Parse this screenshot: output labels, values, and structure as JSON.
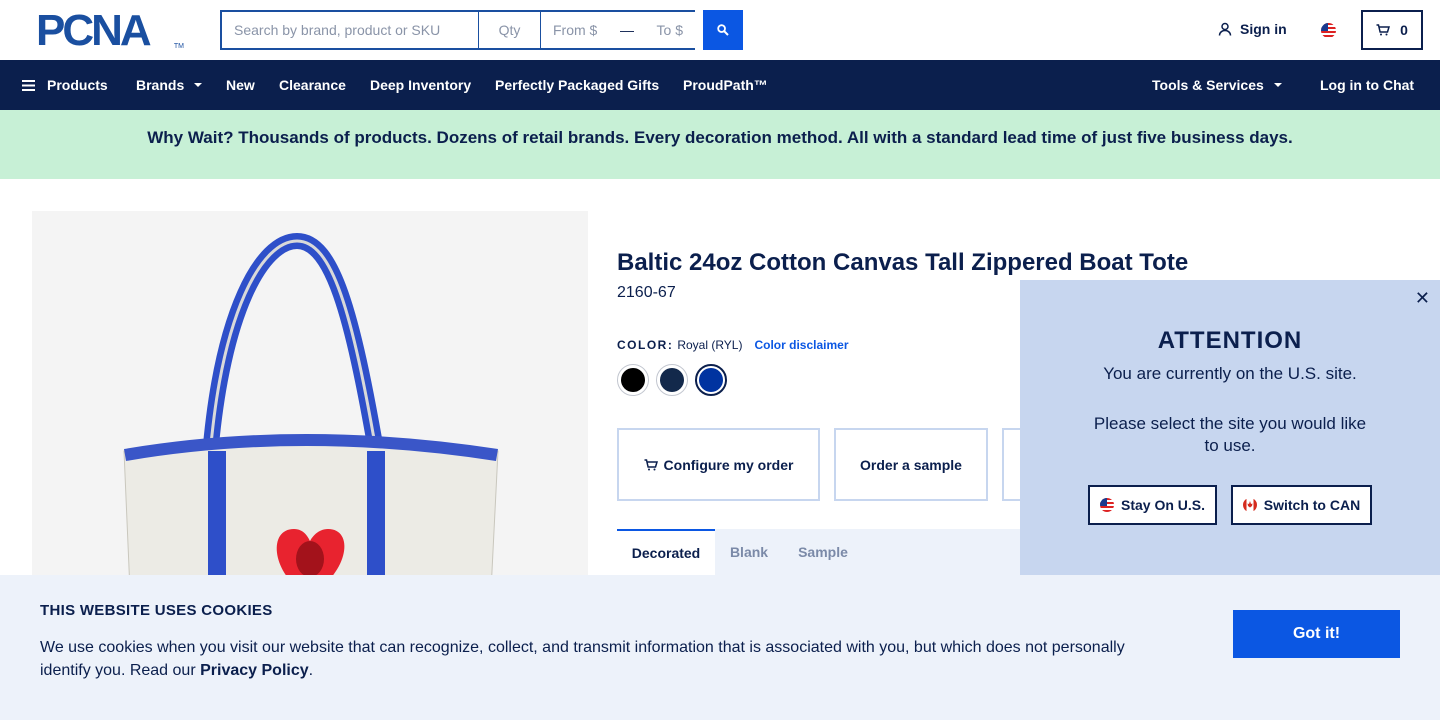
{
  "header": {
    "logo_text": "PCNA",
    "logo_tm": "TM",
    "search_placeholder": "Search by brand, product or SKU",
    "qty_placeholder": "Qty",
    "price_from": "From $",
    "price_to": "To $",
    "sign_in": "Sign in",
    "cart_count": "0"
  },
  "nav": {
    "products": "Products",
    "brands": "Brands",
    "new": "New",
    "clearance": "Clearance",
    "deep_inventory": "Deep Inventory",
    "gifts": "Perfectly Packaged Gifts",
    "proudpath": "ProudPath™",
    "tools": "Tools & Services",
    "chat": "Log in to Chat"
  },
  "promo": {
    "text": "Why Wait? Thousands of products. Dozens of retail brands. Every decoration method. All with a standard lead time of just five business days."
  },
  "product": {
    "title": "Baltic 24oz Cotton Canvas Tall Zippered Boat Tote",
    "sku": "2160-67",
    "color_label": "COLOR:",
    "color_value": "Royal (RYL)",
    "color_disclaimer": "Color disclaimer",
    "swatches": [
      {
        "color": "#000000"
      },
      {
        "color": "#13294b"
      },
      {
        "color": "#0033a0",
        "selected": true
      }
    ],
    "configure_label": "Configure my order",
    "sample_label": "Order a sample",
    "tabs": [
      "Decorated",
      "Blank",
      "Sample"
    ]
  },
  "modal": {
    "title": "ATTENTION",
    "text1": "You are currently on the U.S. site.",
    "text2": "Please select the site you would like to use.",
    "stay_label": "Stay On U.S.",
    "switch_label": "Switch to CAN"
  },
  "cookie": {
    "title": "THIS WEBSITE USES COOKIES",
    "text": "We use cookies when you visit our website that can recognize, collect, and transmit information that is associated with you, but which does not personally identify you. Read our",
    "link": "Privacy Policy",
    "period": ".",
    "button": "Got it!"
  },
  "colors": {
    "navy": "#0b1f4d",
    "brand_blue": "#0b57e3",
    "promo_green": "#c7f0d6",
    "modal_bg": "#c7d6ef"
  }
}
